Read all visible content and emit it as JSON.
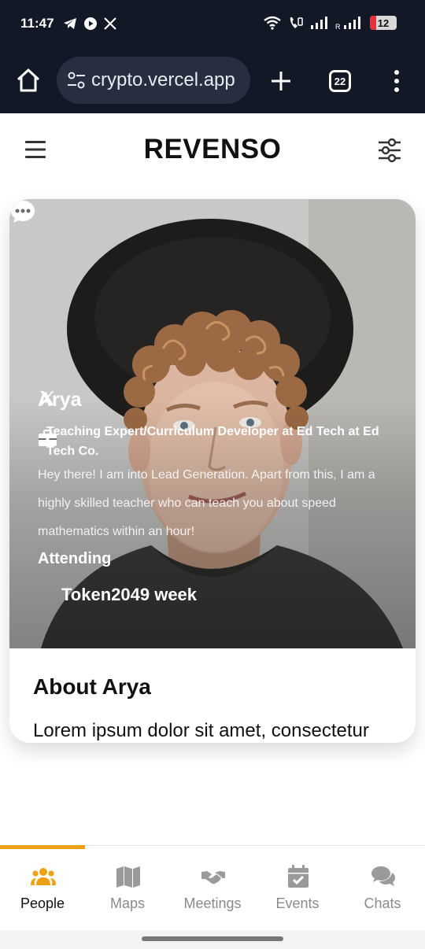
{
  "status_bar": {
    "time": "11:47",
    "battery": "12"
  },
  "browser": {
    "url": "crypto.vercel.app",
    "tab_count": "22"
  },
  "header": {
    "title": "REVENSO"
  },
  "profile": {
    "name": "Arya",
    "job_title": "Teaching Expert/Curriculum Developer at Ed Tech at Ed Tech Co.",
    "bio": "Hey there! I am into Lead Generation. Apart from this, I am a highly skilled teacher who can teach you about speed mathematics within an hour!",
    "attending_label": "Attending",
    "event": "Token2049 week",
    "about_title": "About Arya",
    "about_text": "Lorem ipsum dolor sit amet, consectetur"
  },
  "bottom_nav": {
    "items": [
      {
        "label": "People",
        "icon": "people-icon",
        "active": true
      },
      {
        "label": "Maps",
        "icon": "map-icon",
        "active": false
      },
      {
        "label": "Meetings",
        "icon": "handshake-icon",
        "active": false
      },
      {
        "label": "Events",
        "icon": "calendar-check-icon",
        "active": false
      },
      {
        "label": "Chats",
        "icon": "chat-bubbles-icon",
        "active": false
      }
    ]
  },
  "colors": {
    "accent": "#f0a014",
    "browser_bg": "#121826",
    "inactive_nav": "#8a8a8a"
  }
}
